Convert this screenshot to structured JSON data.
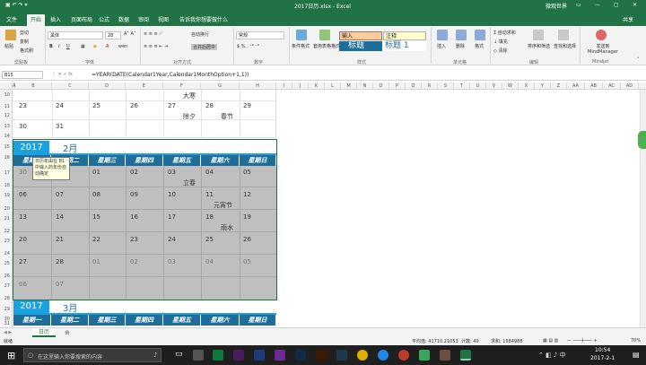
{
  "window": {
    "title": "2017日历.xlsx - Excel",
    "account": "微观世界",
    "share": "共享"
  },
  "tabs": [
    "文件",
    "开始",
    "插入",
    "页面布局",
    "公式",
    "数据",
    "审阅",
    "视图",
    "告诉我你想要做什么"
  ],
  "ribbon": {
    "paste": "粘贴",
    "cut": "剪切",
    "copy": "复制",
    "format_painter": "格式刷",
    "clipboard_group": "剪贴板",
    "font_name": "黑体",
    "font_size": "28",
    "font_group": "字体",
    "wrap_text": "自动换行",
    "merge_center": "合并后居中",
    "align_group": "对齐方式",
    "number_format": "常规",
    "number_group": "数字",
    "conditional_format": "条件格式",
    "table_format": "套用表格格式",
    "style_input": "输入",
    "style_note": "注释",
    "style_title": "标题",
    "style_title1": "标题 1",
    "styles_group": "样式",
    "insert": "插入",
    "delete": "删除",
    "format": "格式",
    "cells_group": "单元格",
    "autosum": "自动求和",
    "fill": "填充",
    "clear": "清除",
    "sort_filter": "排序和筛选",
    "find_select": "查找和选择",
    "edit_group": "编辑",
    "mindmanager": "发送到 MindManager",
    "mindjet_group": "Mindjet"
  },
  "formula_bar": {
    "name_box": "B15",
    "formula": "=YEAR(DATE(Calendar1Year,Calendar1MonthOption+1,1))"
  },
  "columns": [
    "A",
    "B",
    "C",
    "D",
    "E",
    "F",
    "G",
    "H",
    "I",
    "J",
    "K",
    "L",
    "M",
    "N",
    "O",
    "P",
    "Q",
    "R",
    "S",
    "T",
    "U",
    "V",
    "W",
    "X",
    "Y",
    "Z",
    "AA",
    "AB",
    "AC",
    "AD"
  ],
  "rows": [
    "10",
    "11",
    "12",
    "13",
    "14",
    "15",
    "16",
    "17",
    "18",
    "19",
    "20",
    "21",
    "22",
    "23",
    "24",
    "25",
    "26",
    "27",
    "28",
    "29",
    "30",
    "31"
  ],
  "jan_tail": {
    "r10": [
      "",
      "",
      "",
      "",
      "大寒",
      "",
      ""
    ],
    "r11": [
      "23",
      "24",
      "25",
      "26",
      "27",
      "28",
      "29"
    ],
    "r12": [
      "",
      "",
      "",
      "",
      "除夕",
      "春节",
      ""
    ],
    "r13": [
      "30",
      "31"
    ]
  },
  "feb": {
    "year": "2017",
    "month": "2月",
    "weekdays": [
      "星期一",
      "星期二",
      "星期三",
      "星期四",
      "星期五",
      "星期六",
      "星期日"
    ],
    "weeks": [
      [
        "30",
        "31",
        "01",
        "02",
        "03",
        "04",
        "05"
      ],
      [
        "06",
        "07",
        "08",
        "09",
        "10",
        "11",
        "12"
      ],
      [
        "13",
        "14",
        "15",
        "16",
        "17",
        "18",
        "19"
      ],
      [
        "20",
        "21",
        "22",
        "23",
        "24",
        "25",
        "26"
      ],
      [
        "27",
        "28",
        "01",
        "02",
        "03",
        "04",
        "05"
      ],
      [
        "06",
        "07",
        "",
        "",
        "",
        "",
        ""
      ]
    ],
    "notes": {
      "lichun": "立春",
      "yuanxiao": "元宵节",
      "yushui": "雨水"
    },
    "tooltip": "日历年由在 B1 中输入的年份自动确定"
  },
  "mar": {
    "year": "2017",
    "month": "3月"
  },
  "sheet_tab": "日历",
  "status": {
    "ready": "就绪",
    "average": "平均值: 41710.21053",
    "count": "计数: 49",
    "sum": "求和: 1584988",
    "zoom": "70%"
  },
  "taskbar": {
    "search": "在这里输入你要搜索的内容",
    "time": "10:54",
    "date": "2017-2-1"
  },
  "colors": {
    "excel_green": "#217346",
    "header_blue": "#1f6e99",
    "year_blue": "#1ba1e2",
    "gray_cell": "#bfbfbf"
  }
}
